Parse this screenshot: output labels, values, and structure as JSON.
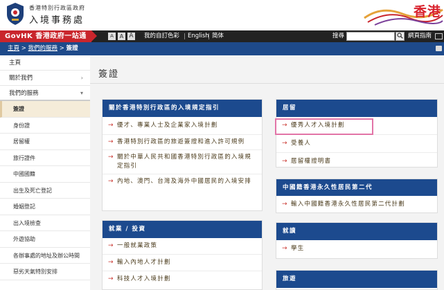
{
  "header": {
    "dept_sub": "香港特別行政區政府",
    "dept_main": "入境事務處",
    "brand": "香港"
  },
  "govbar": {
    "govhk": "GovHK 香港政府一站通",
    "font_buttons": [
      "A",
      "A",
      "A"
    ],
    "color_settings": "我的自訂色彩",
    "english": "English",
    "simplified": "简体",
    "search_label": "搜尋",
    "search_placeholder": "",
    "search_button_icon": "magnifier-icon",
    "sitemap": "網頁指南"
  },
  "breadcrumb": {
    "home": "主頁",
    "sep1": " > ",
    "services": "我們的服務",
    "sep2": " > ",
    "current": "簽證"
  },
  "sidebar": {
    "top_items": [
      {
        "label": "主頁",
        "chev": ""
      },
      {
        "label": "關於我們",
        "chev": "›"
      },
      {
        "label": "我們的服務",
        "chev": "▾"
      }
    ],
    "sub_items": [
      "簽證",
      "身份證",
      "居留權",
      "旅行證件",
      "中國國籍",
      "出生及死亡登記",
      "婚姻登記",
      "出入境檢查",
      "外遊協助",
      "各辦事處的地址及辦公時間",
      "惡劣天氣特別安排"
    ]
  },
  "main": {
    "title": "簽證",
    "cards": {
      "entry": {
        "header": "關於香港特別行政區的入境規定指引",
        "items": [
          "優才、專業人士及企業家入境計劃",
          "香港特別行政區的旅遊簽證和進入許可規例",
          "關於中華人民共和國香港特別行政區的入境規定指引",
          "內地、澳門、台灣及海外中國居民的入境安排"
        ]
      },
      "residence": {
        "header": "居留",
        "items": [
          "優秀人才入境計劃",
          "受養人",
          "居留權證明書"
        ]
      },
      "second_gen": {
        "header": "中國籍香港永久性居民第二代",
        "items": [
          "輸入中國籍香港永久性居民第二代計劃"
        ]
      },
      "employment": {
        "header": "就業 / 投資",
        "items": [
          "一般就業政策",
          "輸入內地人才計劃",
          "科技人才入境計劃"
        ]
      },
      "study": {
        "header": "就讀",
        "items": [
          "學生"
        ]
      },
      "travel": {
        "header": "旅遊"
      }
    }
  },
  "colors": {
    "card_header": "#1c4a8e",
    "govhk_red": "#c9252c",
    "arrow": "#c8302a",
    "highlight": "#e274a7",
    "active_side": "#f5ecd9"
  }
}
